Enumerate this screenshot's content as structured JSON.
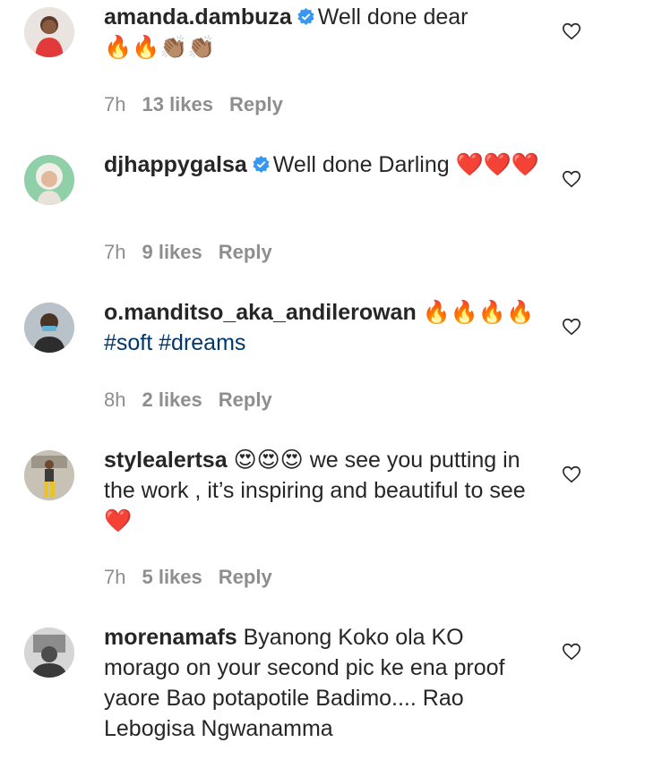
{
  "comments": [
    {
      "username": "amanda.dambuza",
      "verified": true,
      "text": "Well done dear",
      "emoji": "🔥🔥👏🏽👏🏽",
      "time": "7h",
      "likes": "13 likes",
      "reply": "Reply"
    },
    {
      "username": "djhappygalsa",
      "verified": true,
      "text": "Well done Darling",
      "emoji": "❤️❤️❤️",
      "time": "7h",
      "likes": "9 likes",
      "reply": "Reply"
    },
    {
      "username": "o.manditso_aka_andilerowan",
      "verified": false,
      "emoji": "🔥🔥🔥🔥",
      "hashtags": "#soft #dreams",
      "time": "8h",
      "likes": "2 likes",
      "reply": "Reply"
    },
    {
      "username": "stylealertsa",
      "verified": false,
      "emoji_lead": "😍😍😍",
      "text": "we see you putting in the work , it’s inspiring and beautiful to see",
      "emoji_tail": "❤️",
      "time": "7h",
      "likes": "5 likes",
      "reply": "Reply"
    },
    {
      "username": "morenamafs",
      "verified": false,
      "text": "Byanong Koko ola KO morago on your second pic ke ena proof yaore Bao potapotile Badimo.... Rao Lebogisa Ngwanamma"
    }
  ],
  "colors": {
    "text": "#262626",
    "meta": "#8e8e8e",
    "hashtag": "#00376b",
    "verified": "#3897f0"
  },
  "icons": [
    "verified-badge-icon",
    "heart-outline-icon",
    "avatar"
  ]
}
